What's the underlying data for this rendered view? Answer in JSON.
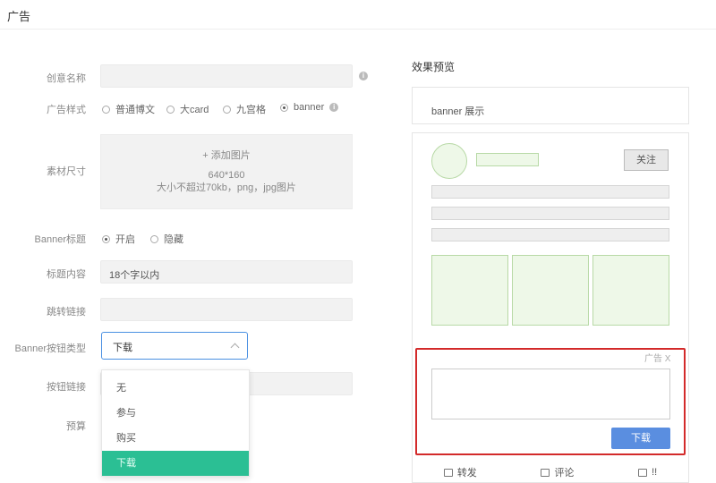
{
  "header": {
    "title": "广告"
  },
  "form": {
    "creative_name_label": "创意名称",
    "info_icon": "i",
    "ad_style_label": "广告样式",
    "ad_style_options": [
      "普通博文",
      "大card",
      "九宫格",
      "banner"
    ],
    "ad_style_selected": 3,
    "material_size_label": "素材尺寸",
    "upload": {
      "add_label": "+ 添加图片",
      "size": "640*160",
      "limit": "大小不超过70kb，png，jpg图片"
    },
    "banner_title_label": "Banner标题",
    "banner_title_options": [
      "开启",
      "隐藏"
    ],
    "banner_title_selected": 0,
    "title_content_label": "标题内容",
    "title_content_value": "18个字以内",
    "jump_link_label": "跳转链接",
    "button_type_label": "Banner按钮类型",
    "button_type_value": "下载",
    "button_link_label": "按钮链接",
    "budget_label": "预算",
    "dropdown_options": [
      "无",
      "参与",
      "购买",
      "下载"
    ],
    "dropdown_selected": 3
  },
  "preview": {
    "title": "效果预览",
    "banner_label": "banner 展示",
    "follow_button": "关注",
    "ad_tag": "广告 X",
    "download_button": "下载",
    "actions": [
      {
        "icon": "share-icon",
        "label": "转发"
      },
      {
        "icon": "comment-icon",
        "label": "评论"
      },
      {
        "icon": "like-icon",
        "label": "!!"
      }
    ]
  },
  "colors": {
    "dropdown_selected_bg": "#2bbf94",
    "download_button_bg": "#5a8ee0",
    "highlight_frame": "#d32a2a"
  }
}
